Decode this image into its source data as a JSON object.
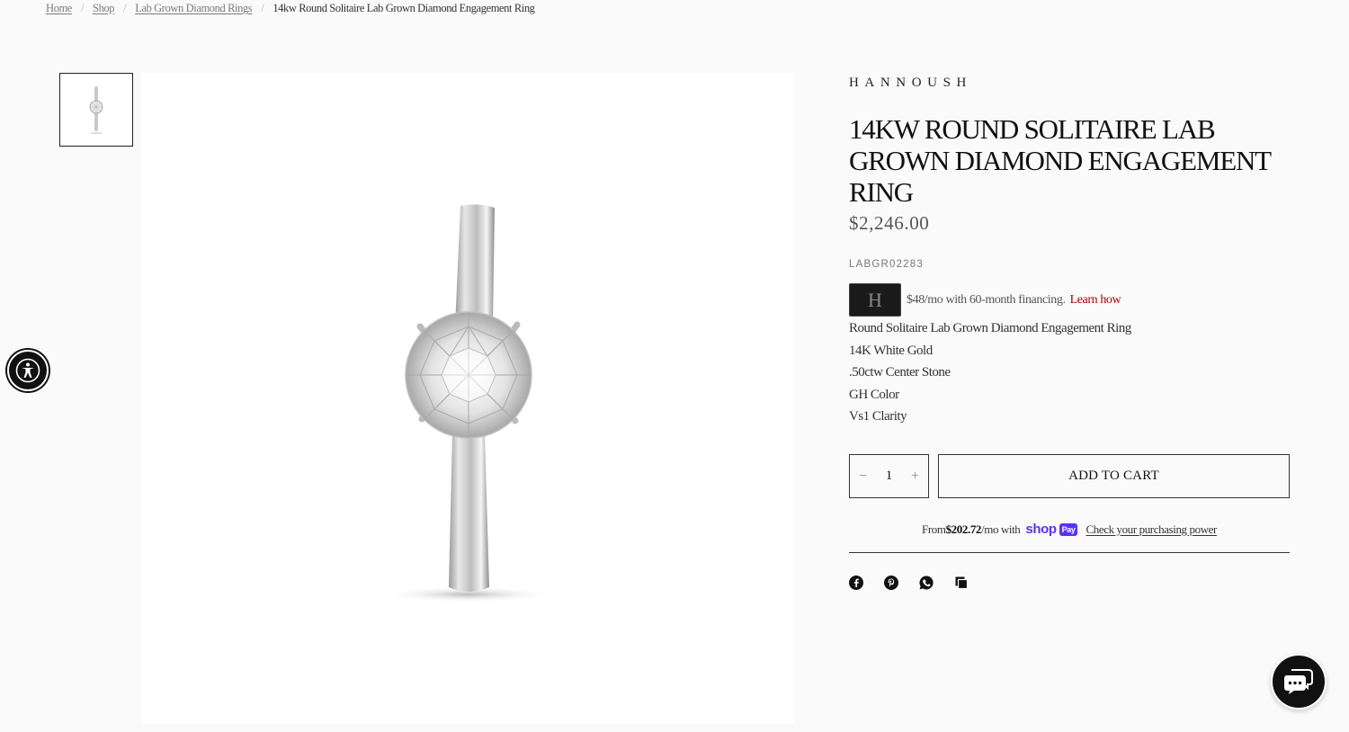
{
  "breadcrumb": {
    "items": [
      "Home",
      "Shop",
      "Lab Grown Diamond Rings"
    ],
    "current": "14kw Round Solitaire Lab Grown Diamond Engagement Ring",
    "separator": "/"
  },
  "product": {
    "brand": "HANNOUSH",
    "title": "14KW ROUND SOLITAIRE LAB GROWN DIAMOND ENGAGEMENT RING",
    "price": "$2,246.00",
    "sku": "LABGR02283",
    "financing": {
      "text": "$48/mo with 60-month financing.",
      "link": "Learn how",
      "card_letter": "H"
    },
    "details": [
      "Round Solitaire Lab Grown Diamond Engagement Ring",
      "14K White Gold",
      ".50ctw Center Stone",
      "GH Color",
      "Vs1 Clarity"
    ]
  },
  "cart": {
    "quantity": "1",
    "minus": "−",
    "plus": "+",
    "add_label": "ADD TO CART"
  },
  "shoppay": {
    "prefix": "From ",
    "amount": "$202.72",
    "suffix": "/mo with",
    "logo_text": "shop",
    "logo_pay": "Pay",
    "link": "Check your purchasing power"
  },
  "share": {
    "icons": [
      "facebook-icon",
      "pinterest-icon",
      "whatsapp-icon",
      "copy-link-icon"
    ]
  },
  "colors": {
    "accent_link": "#b30000",
    "shoppay": "#5a31f4",
    "text": "#111111"
  }
}
